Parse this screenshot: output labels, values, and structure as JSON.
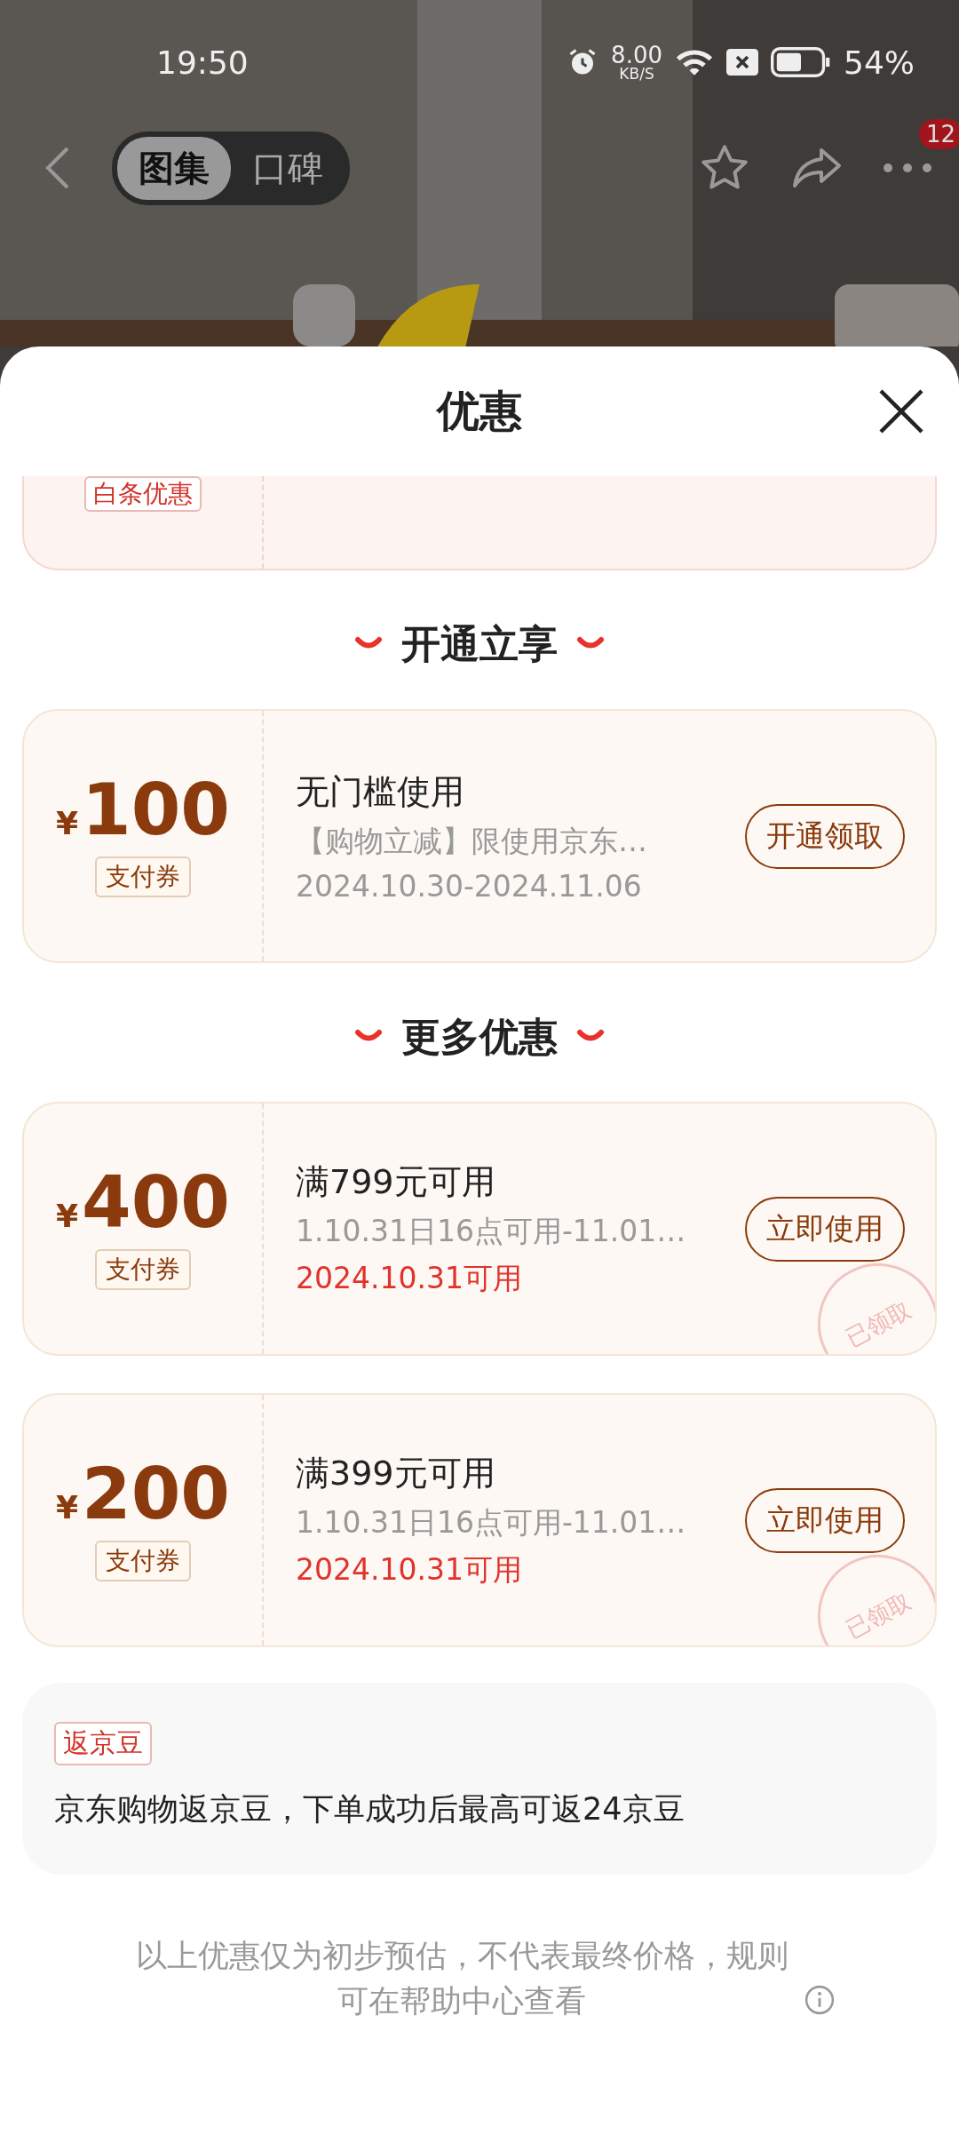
{
  "status_bar": {
    "time": "19:50",
    "net_speed": "8.00",
    "net_unit": "KB/S",
    "battery": "54%"
  },
  "nav": {
    "tabs": [
      {
        "label": "图集",
        "selected": true
      },
      {
        "label": "口碑",
        "selected": false
      }
    ],
    "more_badge": "12"
  },
  "sheet": {
    "title": "优惠",
    "partial_card": {
      "tag": "白条优惠"
    },
    "sections": [
      {
        "heading": "开通立享",
        "coupons": [
          {
            "symbol": "¥",
            "amount": "100",
            "type_tag": "支付券",
            "title": "无门槛使用",
            "desc": "【购物立减】限使用京东…",
            "date": "2024.10.30-2024.11.06",
            "date_highlight": false,
            "button": "开通领取"
          }
        ]
      },
      {
        "heading": "更多优惠",
        "coupons": [
          {
            "symbol": "¥",
            "amount": "400",
            "type_tag": "支付券",
            "title": "满799元可用",
            "desc": "1.10.31日16点可用-11.01…",
            "date": "2024.10.31可用",
            "date_highlight": true,
            "button": "立即使用",
            "stamp": "已领取"
          },
          {
            "symbol": "¥",
            "amount": "200",
            "type_tag": "支付券",
            "title": "满399元可用",
            "desc": "1.10.31日16点可用-11.01…",
            "date": "2024.10.31可用",
            "date_highlight": true,
            "button": "立即使用",
            "stamp": "已领取"
          }
        ]
      }
    ],
    "bean": {
      "tag": "返京豆",
      "text": "京东购物返京豆，下单成功后最高可返24京豆"
    },
    "footer": "以上优惠仅为初步预估，不代表最终价格，规则可在帮助中心查看"
  }
}
